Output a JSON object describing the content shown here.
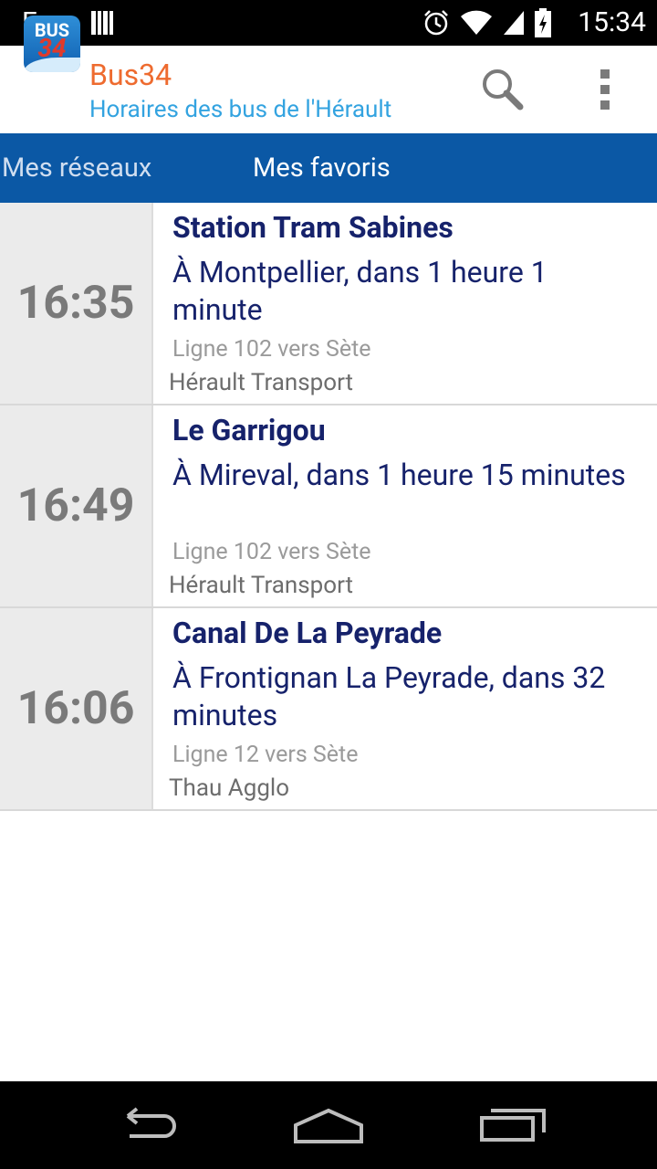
{
  "status_bar": {
    "carrier": "Free",
    "time": "15:34",
    "icons": [
      "sim-card-icon",
      "alarm-clock-icon",
      "wifi-icon",
      "cell-signal-icon",
      "battery-charging-icon"
    ]
  },
  "app": {
    "logo_text_top": "BUS",
    "logo_text_bottom": "34",
    "title": "Bus34",
    "subtitle": "Horaires des bus de l'Hérault",
    "colors": {
      "title": "#ee6b2f",
      "subtitle": "#33a3e0",
      "tab_bar": "#0b58a5",
      "text_primary": "#16226b"
    },
    "actions": [
      "search-icon",
      "overflow-menu-icon"
    ]
  },
  "tabs": [
    {
      "label": "Mes réseaux",
      "selected": false
    },
    {
      "label": "Mes favoris",
      "selected": true
    }
  ],
  "favorites": [
    {
      "time": "16:35",
      "stop": "Station Tram Sabines",
      "destination": "À Montpellier, dans 1 heure 1 minute",
      "line": "Ligne 102 vers Sète",
      "network": "Hérault Transport"
    },
    {
      "time": "16:49",
      "stop": "Le Garrigou",
      "destination": "À Mireval, dans 1 heure 15 minutes",
      "line": "Ligne 102 vers Sète",
      "network": "Hérault Transport"
    },
    {
      "time": "16:06",
      "stop": "Canal De La Peyrade",
      "destination": "À Frontignan La Peyrade, dans 32 minutes",
      "line": "Ligne 12 vers Sète",
      "network": "Thau Agglo"
    }
  ],
  "nav_bar": [
    "back-icon",
    "home-icon",
    "recent-apps-icon"
  ]
}
